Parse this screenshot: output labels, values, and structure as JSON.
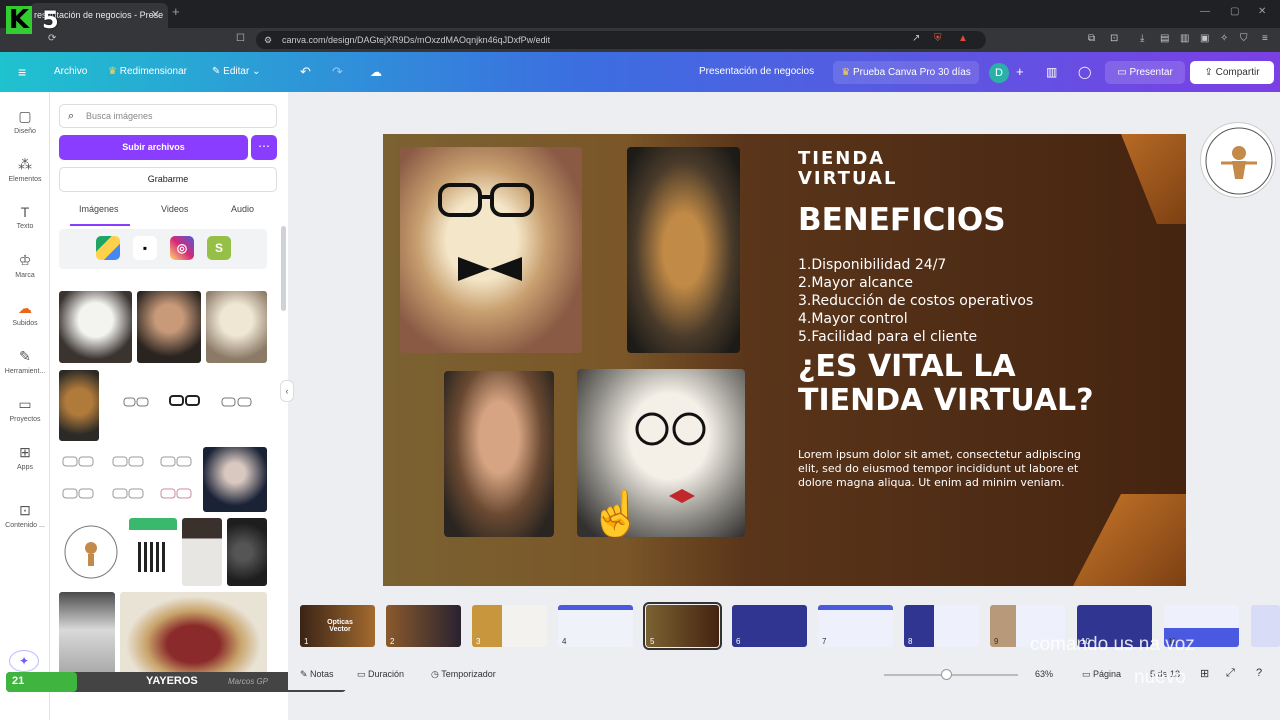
{
  "browser": {
    "tab_title": "resentación de negocios - Prese",
    "url": "canva.com/design/DAGtejXR9Ds/mOxzdMAOqnjkn46qJDxfPw/edit"
  },
  "overlay": {
    "brand_letter": "K",
    "brand_number": "5"
  },
  "header": {
    "file": "Archivo",
    "resize": "Redimensionar",
    "edit": "Editar",
    "design_title": "Presentación de negocios",
    "promo": "Prueba Canva Pro 30 días",
    "avatar": "D",
    "present": "Presentar",
    "share": "Compartir"
  },
  "rail": [
    {
      "icon": "design-icon",
      "label": "Diseño"
    },
    {
      "icon": "elements-icon",
      "label": "Elementos"
    },
    {
      "icon": "text-icon",
      "label": "Texto"
    },
    {
      "icon": "brand-icon",
      "label": "Marca"
    },
    {
      "icon": "uploads-icon",
      "label": "Subidos"
    },
    {
      "icon": "tools-icon",
      "label": "Herramient..."
    },
    {
      "icon": "projects-icon",
      "label": "Proyectos"
    },
    {
      "icon": "apps-icon",
      "label": "Apps"
    },
    {
      "icon": "content-icon",
      "label": "Contenido ..."
    }
  ],
  "panel": {
    "search_placeholder": "Busca imágenes",
    "upload_label": "Subir archivos",
    "record_label": "Grabarme",
    "tabs": [
      "Imágenes",
      "Videos",
      "Audio"
    ],
    "level_name": "YAYEROS",
    "level_num": "21",
    "level_max": "100",
    "level_progress": 0.21,
    "map_caption": "Marcos GP"
  },
  "slide": {
    "eyebrow_line1": "TIENDA",
    "eyebrow_line2": "VIRTUAL",
    "heading": "BENEFICIOS",
    "benefits": [
      "1.Disponibilidad 24/7",
      "2.Mayor alcance",
      "3.Reducción de costos operativos",
      "4.Mayor control",
      "5.Facilidad para el cliente"
    ],
    "question_line1": "¿ES VITAL LA",
    "question_line2": "TIENDA VIRTUAL?",
    "lorem_1": "Lorem ipsum dolor sit amet, consectetur adipiscing",
    "lorem_2": "elit, sed do eiusmod tempor incididunt ut labore et",
    "lorem_3": "dolore magna aliqua. Ut enim ad minim veniam."
  },
  "filmstrip": [
    {
      "num": "1",
      "title": "Opticas Vector"
    },
    {
      "num": "2",
      "title": ""
    },
    {
      "num": "3",
      "title": ""
    },
    {
      "num": "4",
      "title": ""
    },
    {
      "num": "5",
      "title": ""
    },
    {
      "num": "6",
      "title": ""
    },
    {
      "num": "7",
      "title": ""
    },
    {
      "num": "8",
      "title": ""
    },
    {
      "num": "9",
      "title": ""
    },
    {
      "num": "10",
      "title": ""
    },
    {
      "num": "11",
      "title": ""
    }
  ],
  "bottombar": {
    "notes": "Notas",
    "duration": "Duración",
    "timer": "Temporizador",
    "zoom": "63%",
    "page_label": "Página",
    "page_count": "5 de 13"
  },
  "watermark": {
    "line1": "comando us na voz",
    "line2": "nuevo"
  },
  "colors": {
    "accent": "#8b3dff",
    "slide_brown": "#452410",
    "header_start": "#1fc2cf",
    "header_end": "#7b3fe4"
  }
}
